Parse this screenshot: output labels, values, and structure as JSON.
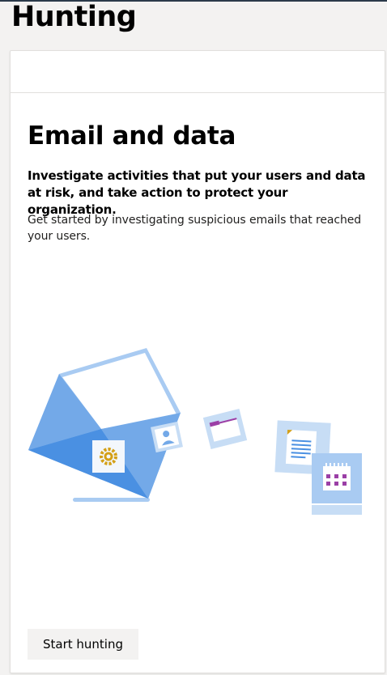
{
  "page": {
    "title": "Hunting"
  },
  "card": {
    "heading": "Email and data",
    "subheading": "Investigate activities that put your users and data at risk, and take action to protect your organization.",
    "body": "Get started by investigating suspicious emails that reached your users.",
    "start_button_label": "Start hunting"
  },
  "illustration": {
    "icons": [
      "envelope-icon",
      "gear-icon",
      "user-icon",
      "folder-icon",
      "document-icon",
      "calendar-icon"
    ]
  },
  "colors": {
    "envelope_dark": "#4a90e2",
    "envelope_mid": "#73a9e8",
    "envelope_light": "#a9cbf2",
    "tile_bg": "#c7ddf5",
    "accent_purple": "#9b3fa6",
    "accent_gold": "#d4a017"
  }
}
